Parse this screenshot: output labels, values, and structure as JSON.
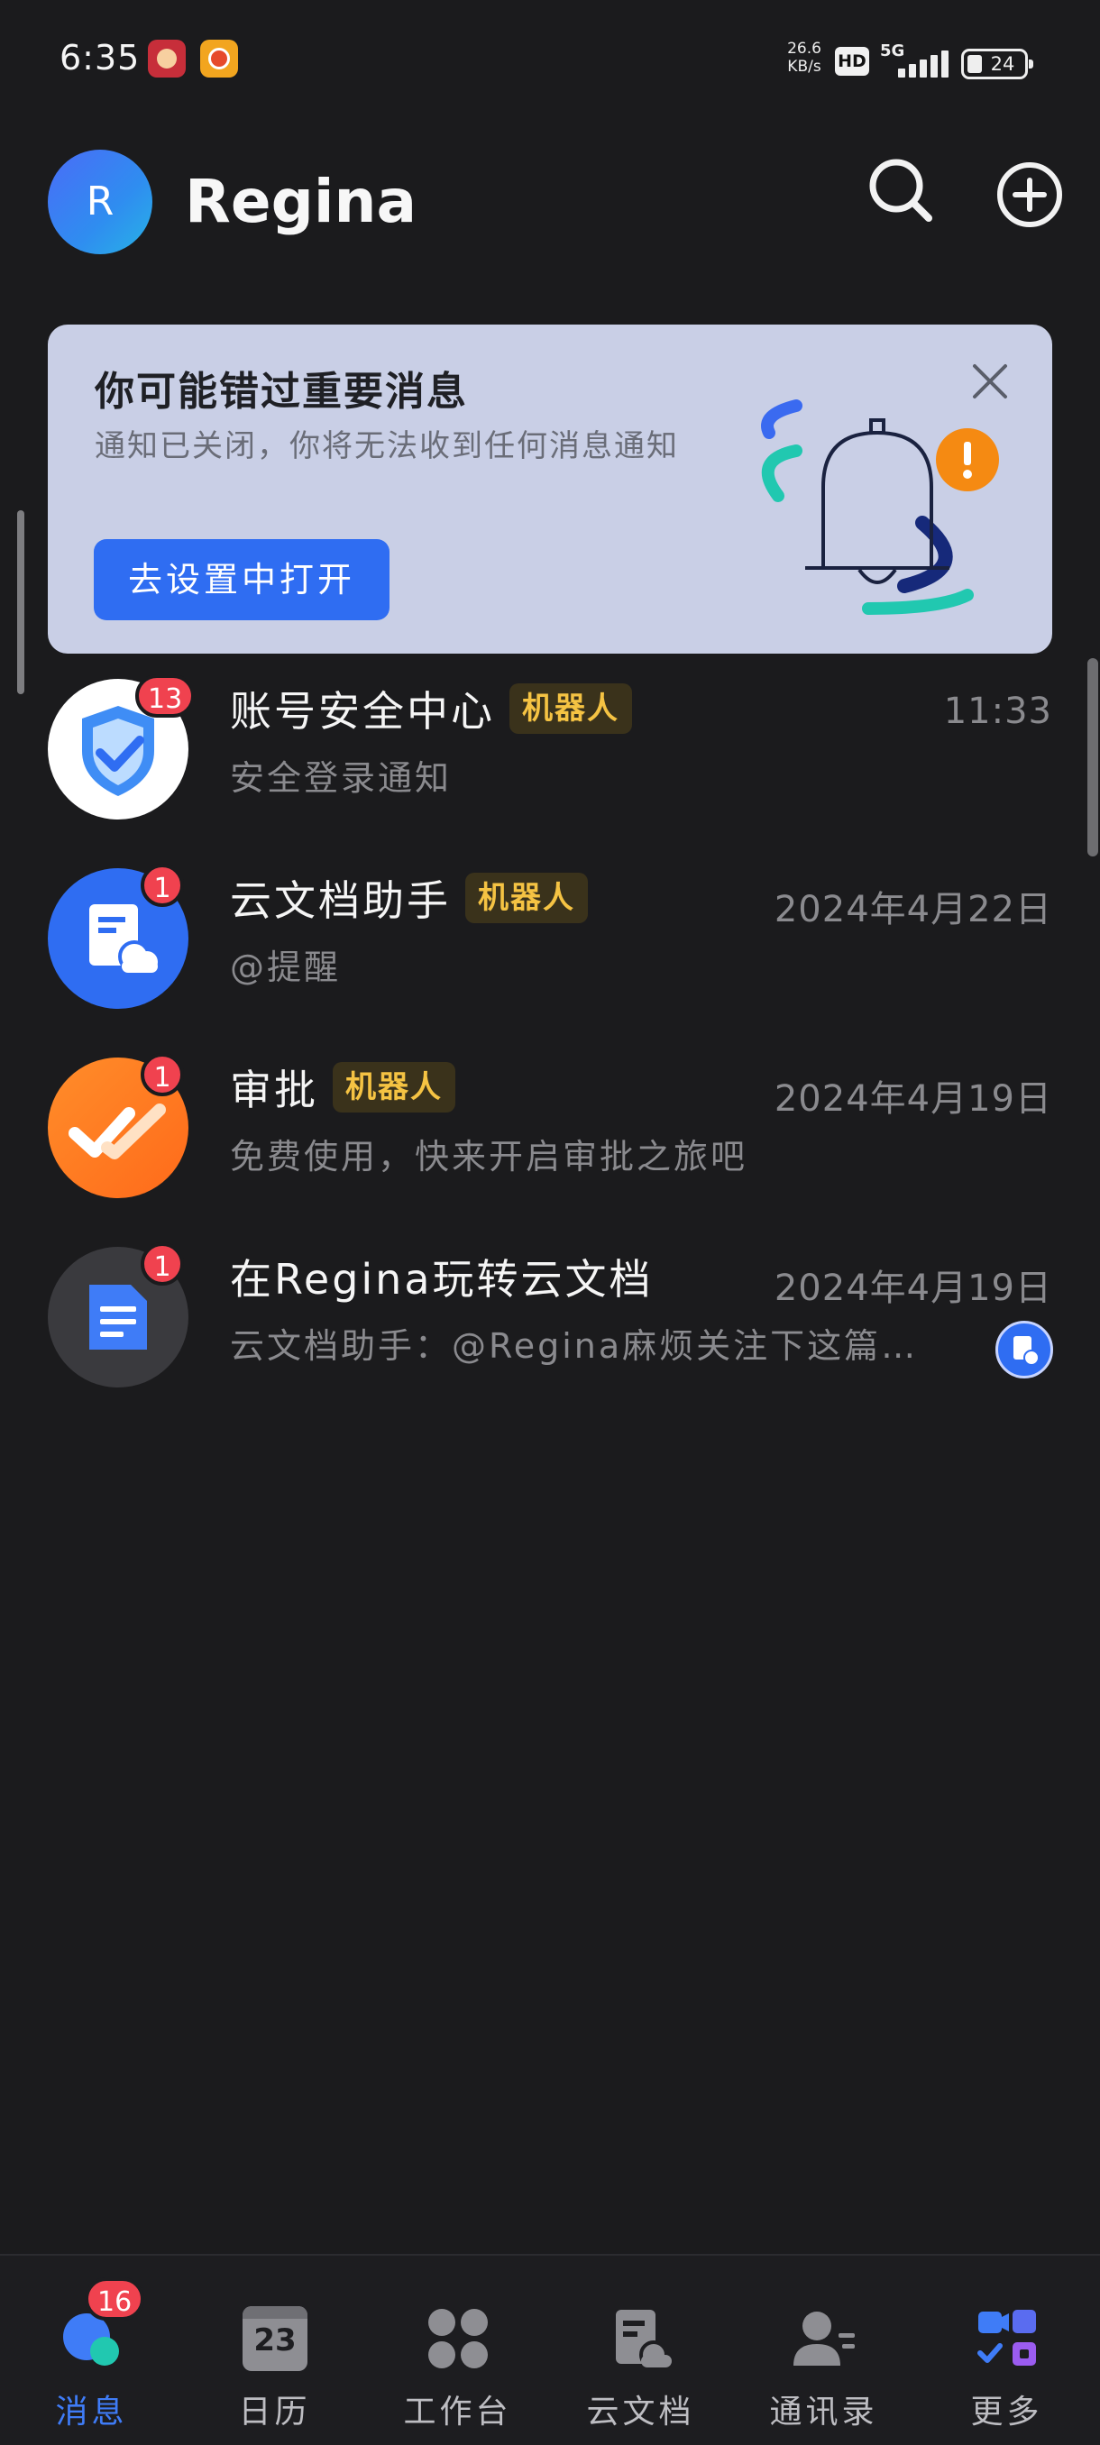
{
  "status_bar": {
    "time": "6:35",
    "net_speed_value": "26.6",
    "net_speed_unit": "KB/s",
    "hd_label": "HD",
    "network_label": "5G",
    "battery": "24"
  },
  "header": {
    "avatar_letter": "R",
    "username": "Regina"
  },
  "notice": {
    "title": "你可能错过重要消息",
    "description": "通知已关闭，你将无法收到任何消息通知",
    "button_label": "去设置中打开"
  },
  "chats": [
    {
      "title": "账号安全中心",
      "tag": "机器人",
      "time": "11:33",
      "preview": "安全登录通知",
      "badge": "13"
    },
    {
      "title": "云文档助手",
      "tag": "机器人",
      "time": "2024年4月22日",
      "preview": "@提醒",
      "badge": "1"
    },
    {
      "title": "审批",
      "tag": "机器人",
      "time": "2024年4月19日",
      "preview": "免费使用，快来开启审批之旅吧",
      "badge": "1"
    },
    {
      "title": "在Regina玩转云文档",
      "tag": "",
      "time": "2024年4月19日",
      "preview": "云文档助手：@Regina麻烦关注下这篇…",
      "badge": "1"
    }
  ],
  "bottom_nav": {
    "messages": {
      "label": "消息",
      "badge": "16"
    },
    "calendar": {
      "label": "日历",
      "date_number": "23"
    },
    "workspace": {
      "label": "工作台"
    },
    "docs": {
      "label": "云文档"
    },
    "contacts": {
      "label": "通讯录"
    },
    "more": {
      "label": "更多"
    }
  },
  "colors": {
    "background": "#1b1b1d",
    "accent": "#2f6df2",
    "badge": "#f0424f",
    "robot_tag_text": "#f5c343",
    "notice_bg": "#c9cfe6"
  }
}
